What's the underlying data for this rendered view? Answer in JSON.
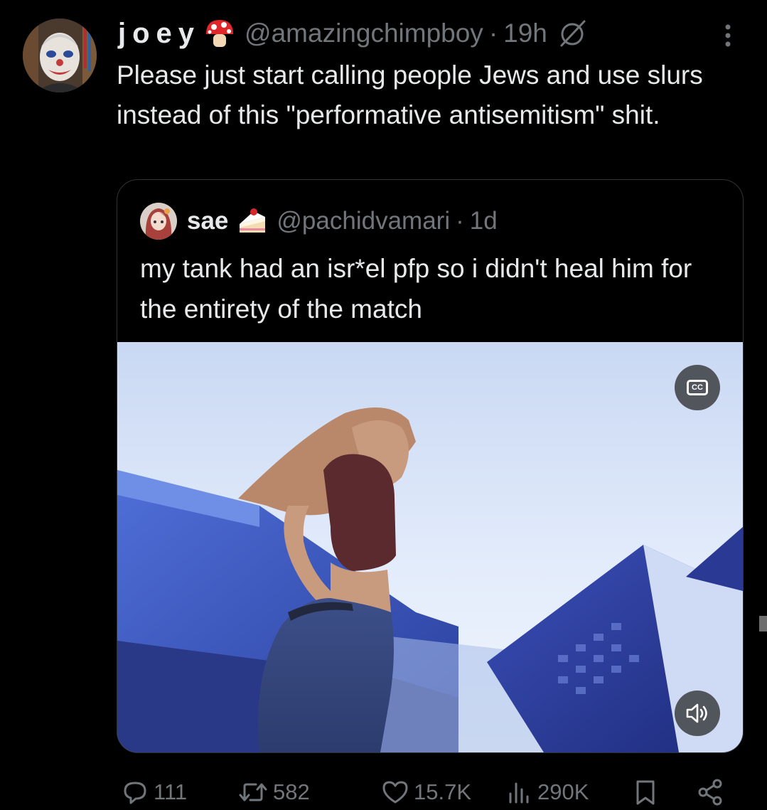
{
  "tweet": {
    "display_name": "joey",
    "handle": "@amazingchimpboy",
    "separator": "·",
    "time": "19h",
    "text": "Please just start calling people Jews and use slurs instead of this \"performative antisemitism\" shit.",
    "avatar_icon": "clown-face-avatar",
    "name_emoji_icon": "mushroom-icon",
    "badge_icon": "ghost-slash-icon"
  },
  "quoted_tweet": {
    "display_name": "sae",
    "handle": "@pachidvamari",
    "separator": "·",
    "time": "1d",
    "text": "my tank had an isr*el pfp so i didn't heal him for the entirety of the match",
    "avatar_icon": "anime-girl-avatar",
    "name_emoji_icon": "cake-slice-icon",
    "media": {
      "type": "video",
      "captions_label": "CC",
      "captions_icon": "captions-icon",
      "sound_icon": "speaker-on-icon"
    }
  },
  "actions": {
    "replies": "111",
    "reposts": "582",
    "likes": "15.7K",
    "views": "290K",
    "reply_icon": "reply-bubble-icon",
    "repost_icon": "repost-icon",
    "like_icon": "heart-icon",
    "views_icon": "views-bar-chart-icon",
    "bookmark_icon": "bookmark-icon",
    "share_icon": "share-icon"
  },
  "colors": {
    "background": "#000000",
    "text_primary": "#e7e9ea",
    "text_secondary": "#71767b",
    "border": "#2f3336"
  }
}
